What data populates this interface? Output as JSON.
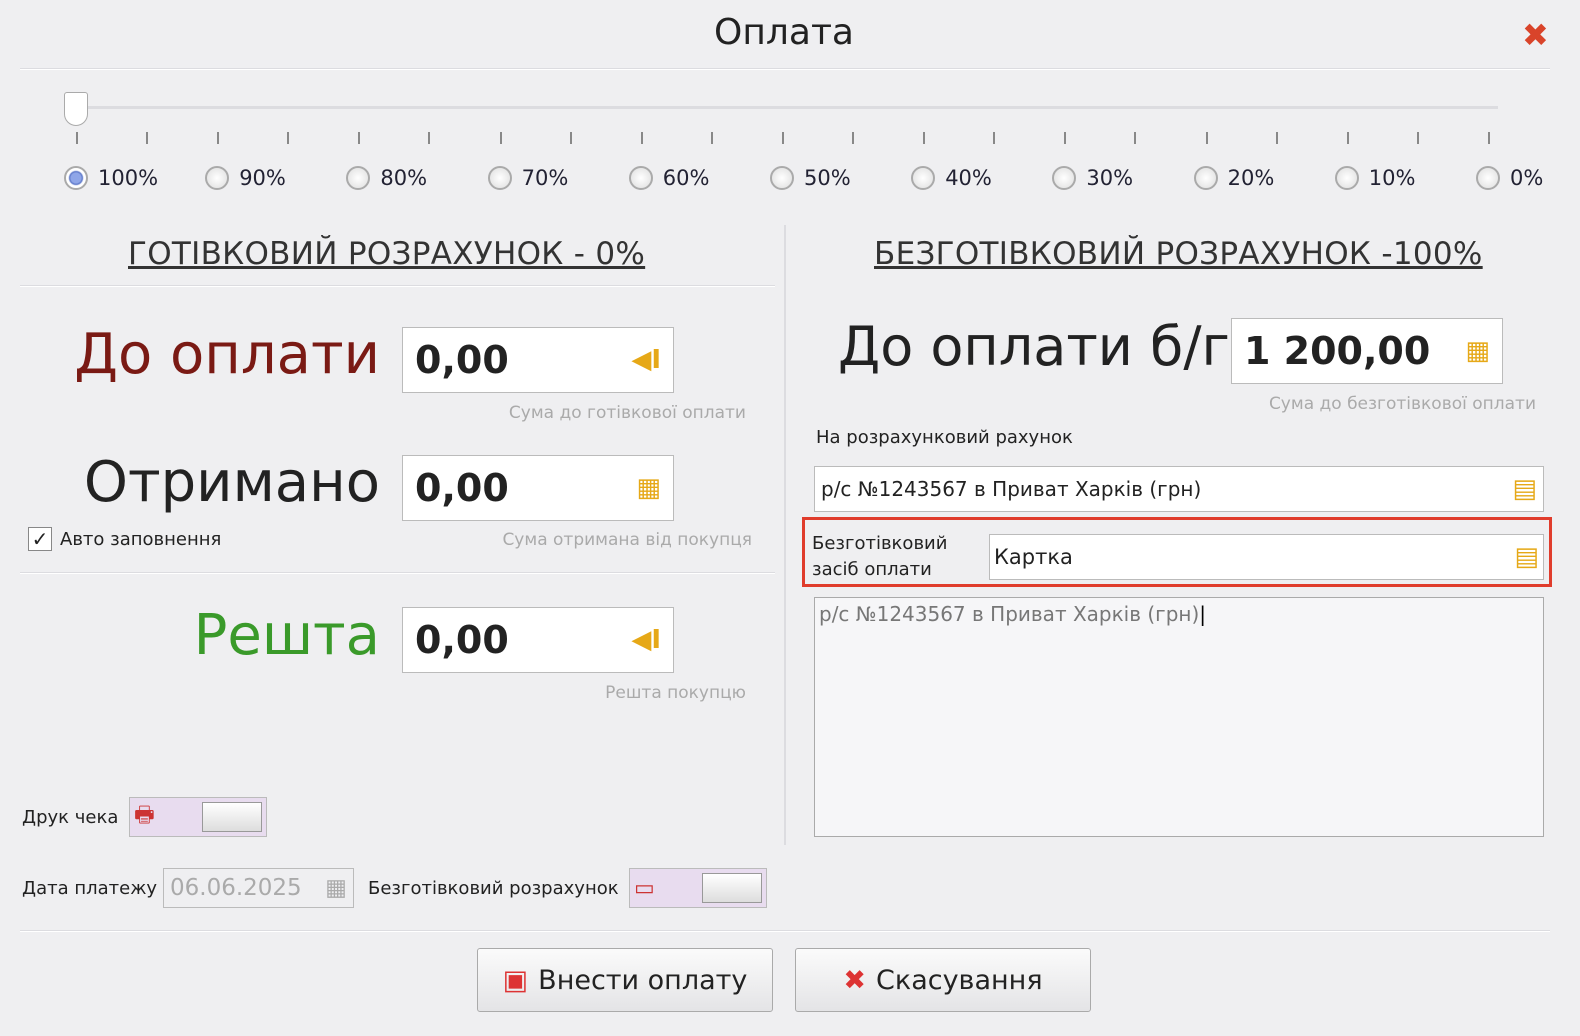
{
  "window": {
    "title": "Оплата"
  },
  "slider": {
    "value_percent": 100,
    "options": [
      "100%",
      "90%",
      "80%",
      "70%",
      "60%",
      "50%",
      "40%",
      "30%",
      "20%",
      "10%",
      "0%"
    ],
    "selected": "100%"
  },
  "cash": {
    "header": "ГОТІВКОВИЙ РОЗРАХУНОК - 0%",
    "to_pay_label": "До оплати",
    "to_pay_value": "0,00",
    "to_pay_hint": "Сума до готівкової оплати",
    "received_label": "Отримано",
    "received_value": "0,00",
    "received_hint": "Сума отримана від покупця",
    "autofill_label": "Авто заповнення",
    "autofill_checked": true,
    "change_label": "Решта",
    "change_value": "0,00",
    "change_hint": "Решта покупцю"
  },
  "cashless": {
    "header": "БЕЗГОТІВКОВИЙ РОЗРАХУНОК -100%",
    "to_pay_label": "До оплати б/г",
    "to_pay_value": "1 200,00",
    "to_pay_hint": "Сума до безготівкової оплати",
    "account_label": "На розрахунковий рахунок",
    "account_value": "р/с №1243567 в Приват Харків (грн)",
    "method_label_1": "Безготівковий",
    "method_label_2": "засіб оплати",
    "method_value": "Картка",
    "note_value": "р/с №1243567 в Приват Харків (грн)",
    "highlight_color": "#e03c2c"
  },
  "bottom": {
    "print_label": "Друк чека",
    "date_label": "Дата платежу",
    "date_value": "06.06.2025",
    "cashless_label": "Безготівковий розрахунок"
  },
  "buttons": {
    "submit": "Внести оплату",
    "cancel": "Скасування"
  },
  "colors": {
    "to_pay": "#7a1a14",
    "change": "#3a9a2a"
  }
}
